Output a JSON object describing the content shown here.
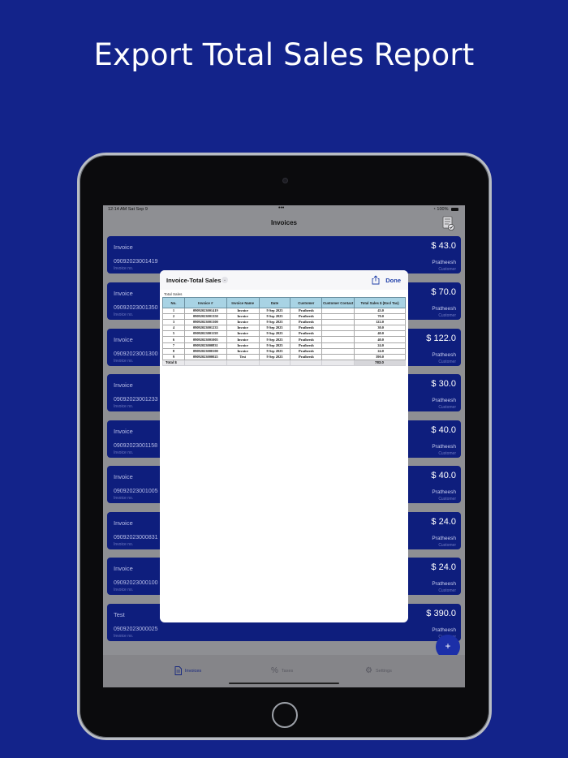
{
  "headline": "Export Total Sales Report",
  "status_bar": {
    "time": "12:14 AM  Sat Sep 9",
    "dots": "•••",
    "battery": "100%"
  },
  "nav": {
    "title": "Invoices"
  },
  "invoices": [
    {
      "title": "Invoice",
      "number": "09092023001419",
      "number_label": "Invoice no.",
      "amount": "$ 43.0",
      "customer": "Pratheesh",
      "customer_label": "Customer"
    },
    {
      "title": "Invoice",
      "number": "09092023001350",
      "number_label": "Invoice no.",
      "amount": "$ 70.0",
      "customer": "Pratheesh",
      "customer_label": "Customer"
    },
    {
      "title": "Invoice",
      "number": "09092023001300",
      "number_label": "Invoice no.",
      "amount": "$ 122.0",
      "customer": "Pratheesh",
      "customer_label": "Customer"
    },
    {
      "title": "Invoice",
      "number": "09092023001233",
      "number_label": "Invoice no.",
      "amount": "$ 30.0",
      "customer": "Pratheesh",
      "customer_label": "Customer"
    },
    {
      "title": "Invoice",
      "number": "09092023001158",
      "number_label": "Invoice no.",
      "amount": "$ 40.0",
      "customer": "Pratheesh",
      "customer_label": "Customer"
    },
    {
      "title": "Invoice",
      "number": "09092023001005",
      "number_label": "Invoice no.",
      "amount": "$ 40.0",
      "customer": "Pratheesh",
      "customer_label": "Customer"
    },
    {
      "title": "Invoice",
      "number": "09092023000831",
      "number_label": "Invoice no.",
      "amount": "$ 24.0",
      "customer": "Pratheesh",
      "customer_label": "Customer"
    },
    {
      "title": "Invoice",
      "number": "09092023000100",
      "number_label": "Invoice no.",
      "amount": "$ 24.0",
      "customer": "Pratheesh",
      "customer_label": "Customer"
    },
    {
      "title": "Test",
      "number": "09092023000025",
      "number_label": "Invoice no.",
      "amount": "$ 390.0",
      "customer": "Pratheesh",
      "customer_label": "Customer"
    }
  ],
  "fab": {
    "label": "+"
  },
  "tabs": [
    {
      "label": "Invoices",
      "icon": "document-icon"
    },
    {
      "label": "Taxes",
      "icon": "percent-icon"
    },
    {
      "label": "Settings",
      "icon": "gear-icon"
    }
  ],
  "sheet": {
    "title": "Invoice-Total Sales",
    "chevron": "⌄",
    "done_label": "Done",
    "report_label": "Total Sales",
    "columns": [
      "No.",
      "Invoice #",
      "Invoice Name",
      "Date",
      "Customer",
      "Customer Contact",
      "Total Sales $ (Excl Tax)"
    ],
    "rows": [
      [
        "1",
        "09092023001419",
        "Invoice",
        "9 Sep 2023",
        "Pratheesh",
        "",
        "43.0"
      ],
      [
        "2",
        "09092023001350",
        "Invoice",
        "9 Sep 2023",
        "Pratheesh",
        "",
        "70.0"
      ],
      [
        "3",
        "09092023001300",
        "Invoice",
        "9 Sep 2023",
        "Pratheesh",
        "",
        "122.0"
      ],
      [
        "4",
        "09092023001233",
        "Invoice",
        "9 Sep 2023",
        "Pratheesh",
        "",
        "30.0"
      ],
      [
        "5",
        "09092023001158",
        "Invoice",
        "9 Sep 2023",
        "Pratheesh",
        "",
        "40.0"
      ],
      [
        "6",
        "09092023001005",
        "Invoice",
        "9 Sep 2023",
        "Pratheesh",
        "",
        "40.0"
      ],
      [
        "7",
        "09092023000831",
        "Invoice",
        "9 Sep 2023",
        "Pratheesh",
        "",
        "24.0"
      ],
      [
        "8",
        "09092023000100",
        "Invoice",
        "9 Sep 2023",
        "Pratheesh",
        "",
        "24.0"
      ],
      [
        "9",
        "09092023000025",
        "Test",
        "9 Sep 2023",
        "Pratheesh",
        "",
        "390.0"
      ]
    ],
    "total_label": "Total $",
    "total_value": "783.0"
  },
  "colors": {
    "background": "#13238a",
    "card": "#0e1e7d",
    "accent": "#1e3ea8",
    "table_header": "#a8d3e4"
  }
}
